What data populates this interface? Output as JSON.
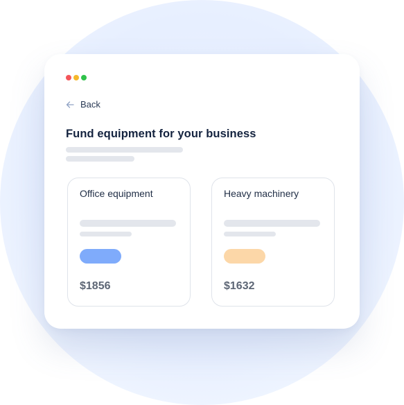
{
  "colors": {
    "dot_red": "#f4555a",
    "dot_yellow": "#f5b72a",
    "dot_green": "#2fc24a",
    "office_pill": "#7fabfb",
    "machinery_pill": "#fcd7a8",
    "title_text": "#14233f",
    "price_text": "#5d6675"
  },
  "nav": {
    "back_label": "Back",
    "back_icon": "arrow-left-icon"
  },
  "page": {
    "title": "Fund equipment for your business"
  },
  "cards": [
    {
      "title": "Office equipment",
      "price": "$1856",
      "accent": "#7fabfb"
    },
    {
      "title": "Heavy machinery",
      "price": "$1632",
      "accent": "#fcd7a8"
    }
  ]
}
